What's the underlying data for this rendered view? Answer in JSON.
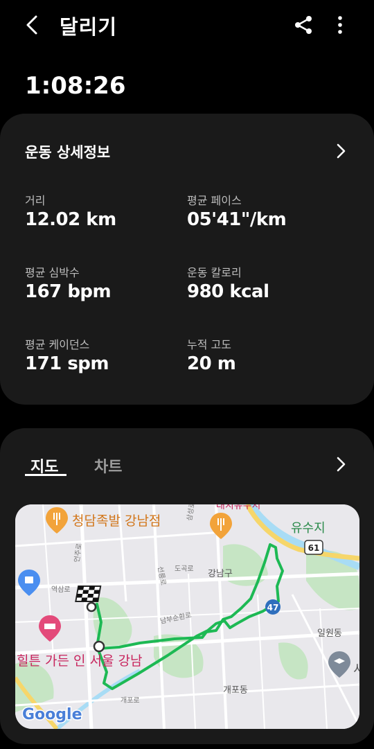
{
  "header": {
    "title": "달리기",
    "icons": [
      "back-icon",
      "share-icon",
      "more-vert-icon"
    ]
  },
  "duration": "1:08:26",
  "details": {
    "title": "운동 상세정보",
    "stats": [
      {
        "label": "거리",
        "value": "12.02 km"
      },
      {
        "label": "평균 페이스",
        "value": "05'41\"/km"
      },
      {
        "label": "평균 심박수",
        "value": "167 bpm"
      },
      {
        "label": "운동 칼로리",
        "value": "980 kcal"
      },
      {
        "label": "평균 케이던스",
        "value": "171 spm"
      },
      {
        "label": "누적 고도",
        "value": "20 m"
      }
    ]
  },
  "tabs": {
    "map": "지도",
    "chart": "차트",
    "selected": "지도"
  },
  "map": {
    "places": {
      "restaurant": "청담족발 강남점",
      "hotel": "힐튼 가든 인 서울 강남",
      "park": "유수지",
      "district": "강남구",
      "dong": "개포동",
      "ilwon": "일원동",
      "yeoksam": "역삼로",
      "eonju": "언주로",
      "seolleung": "선릉로",
      "dogok": "도곡로",
      "nambu": "남부순환로",
      "gaepo_ro": "개포로",
      "samseong": "삼성로",
      "top_partial": "대치유수지",
      "edge_partial": "서"
    },
    "road_badges": [
      "61",
      "47"
    ],
    "brand": "Google",
    "colors": {
      "route": "#1db954",
      "map_bg": "#e9e8ec",
      "park": "#c6e5c4",
      "water": "#a8dcf5",
      "highway": "#f6d66a"
    }
  }
}
